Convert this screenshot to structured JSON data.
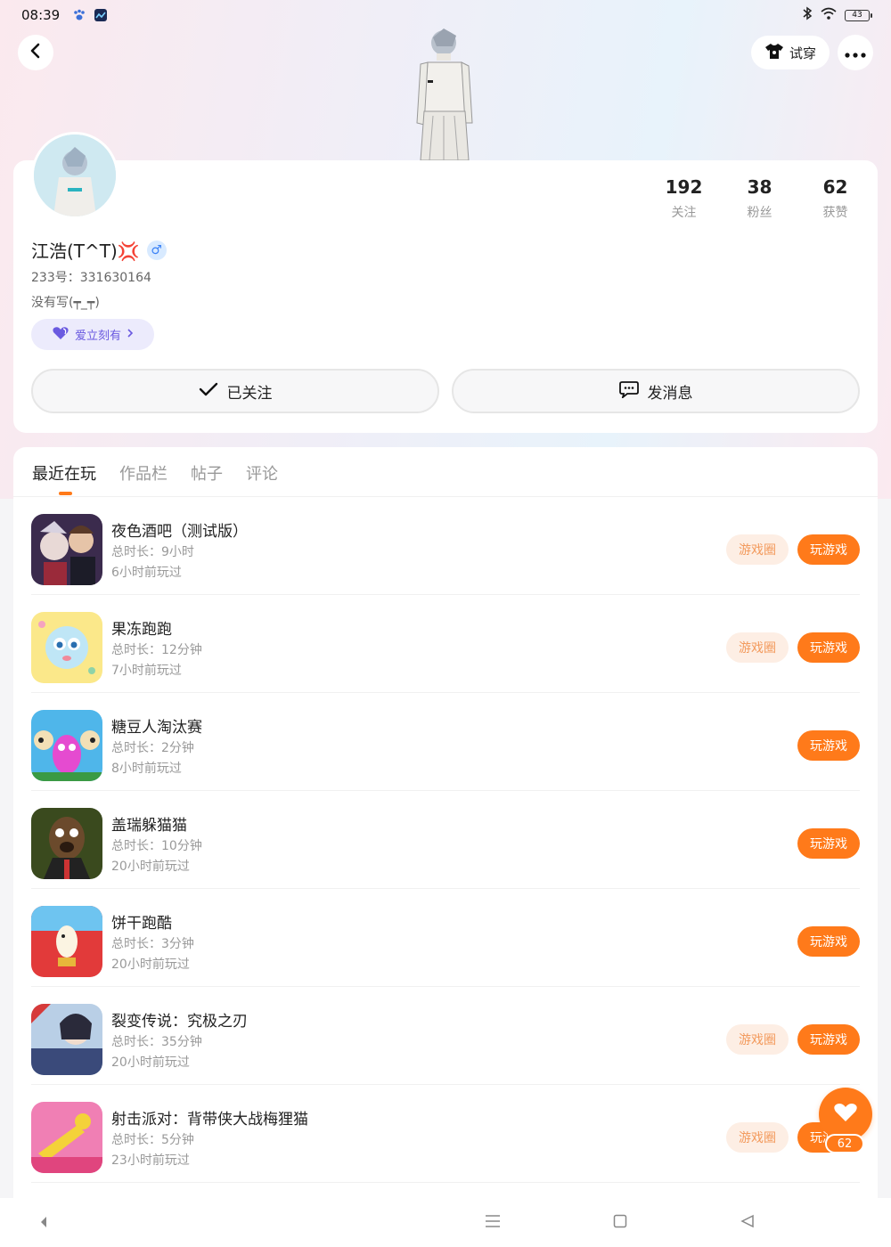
{
  "status_bar": {
    "time": "08:39",
    "battery": "43"
  },
  "header": {
    "tryon_label": "试穿"
  },
  "profile": {
    "name": "江浩(T^T)💢",
    "gender_symbol": "♂",
    "uid": "233号：331630164",
    "bio": "没有写(┯_┯)",
    "badge_label": "爱立刻有",
    "stats": [
      {
        "num": "192",
        "label": "关注"
      },
      {
        "num": "38",
        "label": "粉丝"
      },
      {
        "num": "62",
        "label": "获赞"
      }
    ],
    "follow_label": "已关注",
    "message_label": "发消息"
  },
  "tabs": [
    "最近在玩",
    "作品栏",
    "帖子",
    "评论"
  ],
  "games": [
    {
      "title": "夜色酒吧（测试版）",
      "duration": "总时长：9小时",
      "last_played": "6小时前玩过",
      "circle_label": "游戏圈",
      "play_label": "玩游戏"
    },
    {
      "title": "果冻跑跑",
      "duration": "总时长：12分钟",
      "last_played": "7小时前玩过",
      "circle_label": "游戏圈",
      "play_label": "玩游戏"
    },
    {
      "title": "糖豆人淘汰赛",
      "duration": "总时长：2分钟",
      "last_played": "8小时前玩过",
      "play_label": "玩游戏"
    },
    {
      "title": "盖瑞躲猫猫",
      "duration": "总时长：10分钟",
      "last_played": "20小时前玩过",
      "play_label": "玩游戏"
    },
    {
      "title": "饼干跑酷",
      "duration": "总时长：3分钟",
      "last_played": "20小时前玩过",
      "play_label": "玩游戏"
    },
    {
      "title": "裂变传说：究极之刃",
      "duration": "总时长：35分钟",
      "last_played": "20小时前玩过",
      "circle_label": "游戏圈",
      "play_label": "玩游戏"
    },
    {
      "title": "射击派对：背带侠大战梅狸猫",
      "duration": "总时长：5分钟",
      "last_played": "23小时前玩过",
      "circle_label": "游戏圈",
      "play_label": "玩游戏"
    }
  ],
  "fab": {
    "count": "62"
  },
  "colors": {
    "accent": "#ff7a1a",
    "circle_bg": "#fdeee4",
    "badge_purple": "#6a5ae0"
  }
}
